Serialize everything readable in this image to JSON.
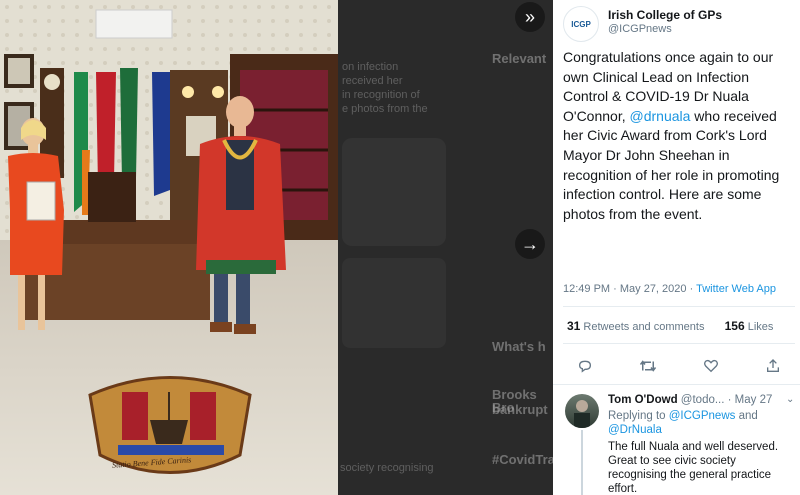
{
  "media": {
    "ghost_lines": [
      "on infection",
      "received her",
      "in recognition of",
      "e photos from the"
    ],
    "ghost_relevant": "Relevant",
    "ghost_whats": "What's h",
    "ghost_trending": "#CovidTra",
    "ghost_brooks": "Brooks Bro",
    "ghost_bankrupt": "bankrupt",
    "ghost_society": "society recognising",
    "seal_motto": "Statio Bene Fide Carinis"
  },
  "tweet": {
    "display_name": "Irish College of GPs",
    "handle": "@ICGPnews",
    "avatar_text": "ICGP",
    "text_1": "Congratulations once again to our own Clinical Lead on Infection Control & COVID-19 Dr Nuala O'Connor, ",
    "mention_1": "@drnuala",
    "text_2": " who received her Civic Award from Cork's Lord Mayor Dr John Sheehan in recognition of her role in promoting infection control. Here are some photos from the event.",
    "time": "12:49 PM · May 27, 2020 · ",
    "app": "Twitter Web App",
    "retweets_count": "31",
    "retweets_label": " Retweets and comments",
    "likes_count": "156",
    "likes_label": " Likes"
  },
  "reply": {
    "name": "Tom O'Dowd",
    "handle_date": " @todo... · May 27",
    "replying_to": "Replying to ",
    "mention_a": "@ICGPnews",
    "and": " and",
    "mention_b": "@DrNuala",
    "text": "The full Nuala and well deserved. Great to see civic society recognising the general practice effort."
  },
  "icons": [
    "collapse-panel-icon",
    "next-image-icon",
    "reply-icon",
    "retweet-icon",
    "like-icon",
    "share-icon",
    "more-icon"
  ]
}
